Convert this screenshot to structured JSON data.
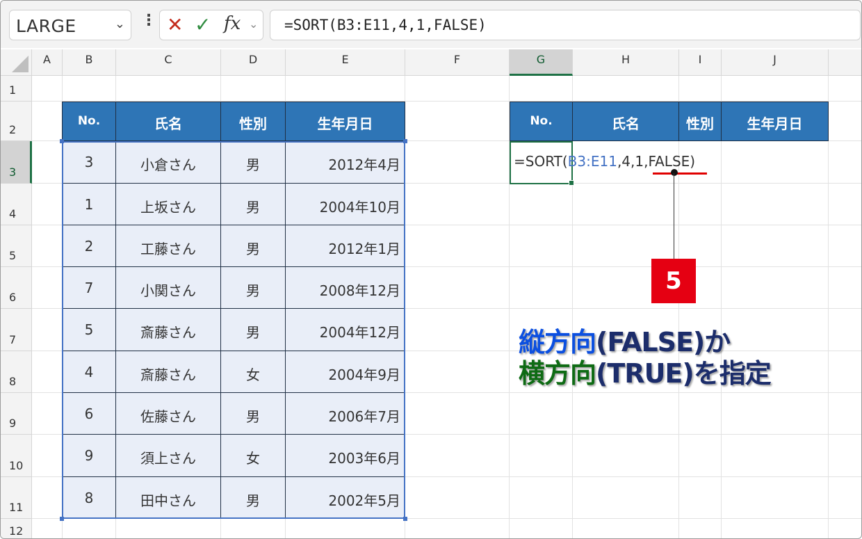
{
  "formula_bar": {
    "name_box": "LARGE",
    "formula": "=SORT(B3:E11,4,1,FALSE)",
    "cancel_icon": "close-icon",
    "enter_icon": "check-icon",
    "fx_label": "fx"
  },
  "columns": [
    "A",
    "B",
    "C",
    "D",
    "E",
    "F",
    "G",
    "H",
    "I",
    "J"
  ],
  "rows": [
    "1",
    "2",
    "3",
    "4",
    "5",
    "6",
    "7",
    "8",
    "9",
    "10",
    "11",
    "12"
  ],
  "source_table": {
    "headers": [
      "No.",
      "氏名",
      "性別",
      "生年月日"
    ],
    "rows": [
      [
        "3",
        "小倉さん",
        "男",
        "2012年4月"
      ],
      [
        "1",
        "上坂さん",
        "男",
        "2004年10月"
      ],
      [
        "2",
        "工藤さん",
        "男",
        "2012年1月"
      ],
      [
        "7",
        "小関さん",
        "男",
        "2008年12月"
      ],
      [
        "5",
        "斎藤さん",
        "男",
        "2004年12月"
      ],
      [
        "4",
        "斎藤さん",
        "女",
        "2004年9月"
      ],
      [
        "6",
        "佐藤さん",
        "男",
        "2006年7月"
      ],
      [
        "9",
        "須上さん",
        "女",
        "2003年6月"
      ],
      [
        "8",
        "田中さん",
        "男",
        "2002年5月"
      ]
    ]
  },
  "output_table": {
    "headers": [
      "No.",
      "氏名",
      "性別",
      "生年月日"
    ]
  },
  "cell_edit": {
    "prefix": "=SORT(",
    "range": "B3:E11",
    "suffix": ",4,1,FALSE)"
  },
  "callout": {
    "number": "5",
    "line1_part1": "縦方向",
    "line1_part2": "(FALSE)か",
    "line2_part1": "横方向",
    "line2_part2": "(TRUE)を指定"
  }
}
